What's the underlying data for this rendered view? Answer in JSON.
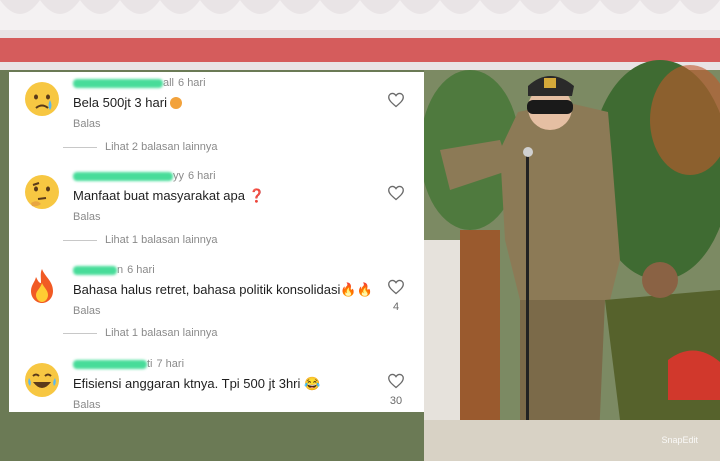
{
  "comments": [
    {
      "username_visible": "all",
      "time": "6 hari",
      "text": "Bela 500jt 3 hari",
      "inline_emoji": "sad-face",
      "reply": "Balas",
      "more": "Lihat 2 balasan lainnya",
      "likes": "",
      "avatar_icon": "crying-face-icon"
    },
    {
      "username_visible": "yy",
      "time": "6 hari",
      "text": "Manfaat buat masyarakat apa ❓",
      "reply": "Balas",
      "more": "Lihat 1 balasan lainnya",
      "likes": "",
      "avatar_icon": "thinking-face-icon"
    },
    {
      "username_visible": "n",
      "time": "6 hari",
      "text": "Bahasa halus retret, bahasa politik konsolidasi🔥🔥",
      "reply": "Balas",
      "more": "Lihat 1 balasan lainnya",
      "likes": "4",
      "avatar_icon": "fire-icon"
    },
    {
      "username_visible": "ti",
      "time": "7 hari",
      "text": "Efisiensi anggaran ktnya. Tpi 500 jt 3hri 😂",
      "reply": "Balas",
      "more": "",
      "likes": "30",
      "avatar_icon": "laughing-face-icon"
    }
  ],
  "watermark": "SnapEdit",
  "colors": {
    "redaction": "#35d98f",
    "uniform": "#8c7a56",
    "tent_red": "#c94a4a"
  }
}
